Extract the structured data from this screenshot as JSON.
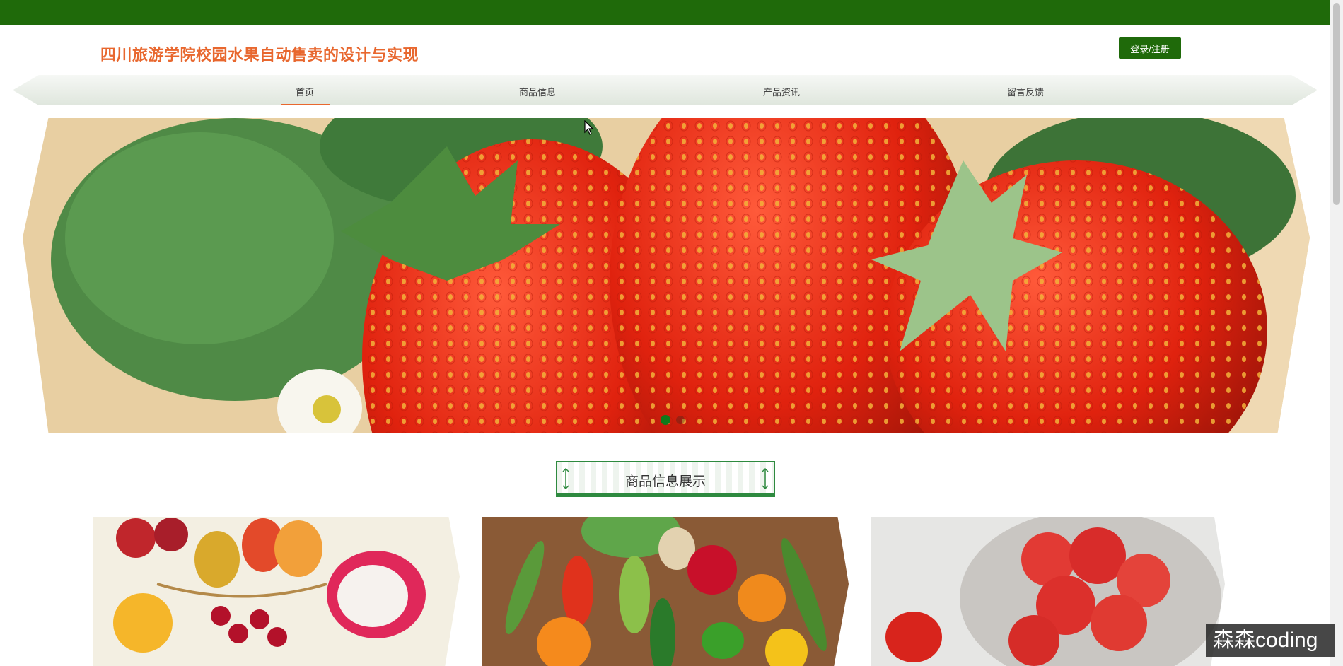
{
  "header": {
    "site_title": "四川旅游学院校园水果自动售卖的设计与实现",
    "login_label": "登录/注册",
    "brand_color": "#1f6a0a",
    "accent_color": "#e8672e"
  },
  "nav": {
    "items": [
      {
        "label": "首页",
        "active": true
      },
      {
        "label": "商品信息",
        "active": false
      },
      {
        "label": "产品资讯",
        "active": false
      },
      {
        "label": "留言反馈",
        "active": false
      }
    ]
  },
  "banner": {
    "image": "strawberries-photo",
    "slides": 2,
    "active_slide": 1
  },
  "section": {
    "title": "商品信息展示"
  },
  "products": [
    {
      "image": "fruit-basket-photo"
    },
    {
      "image": "vegetables-photo"
    },
    {
      "image": "strawberry-bowl-photo"
    }
  ],
  "watermark": {
    "text": "森森coding"
  }
}
